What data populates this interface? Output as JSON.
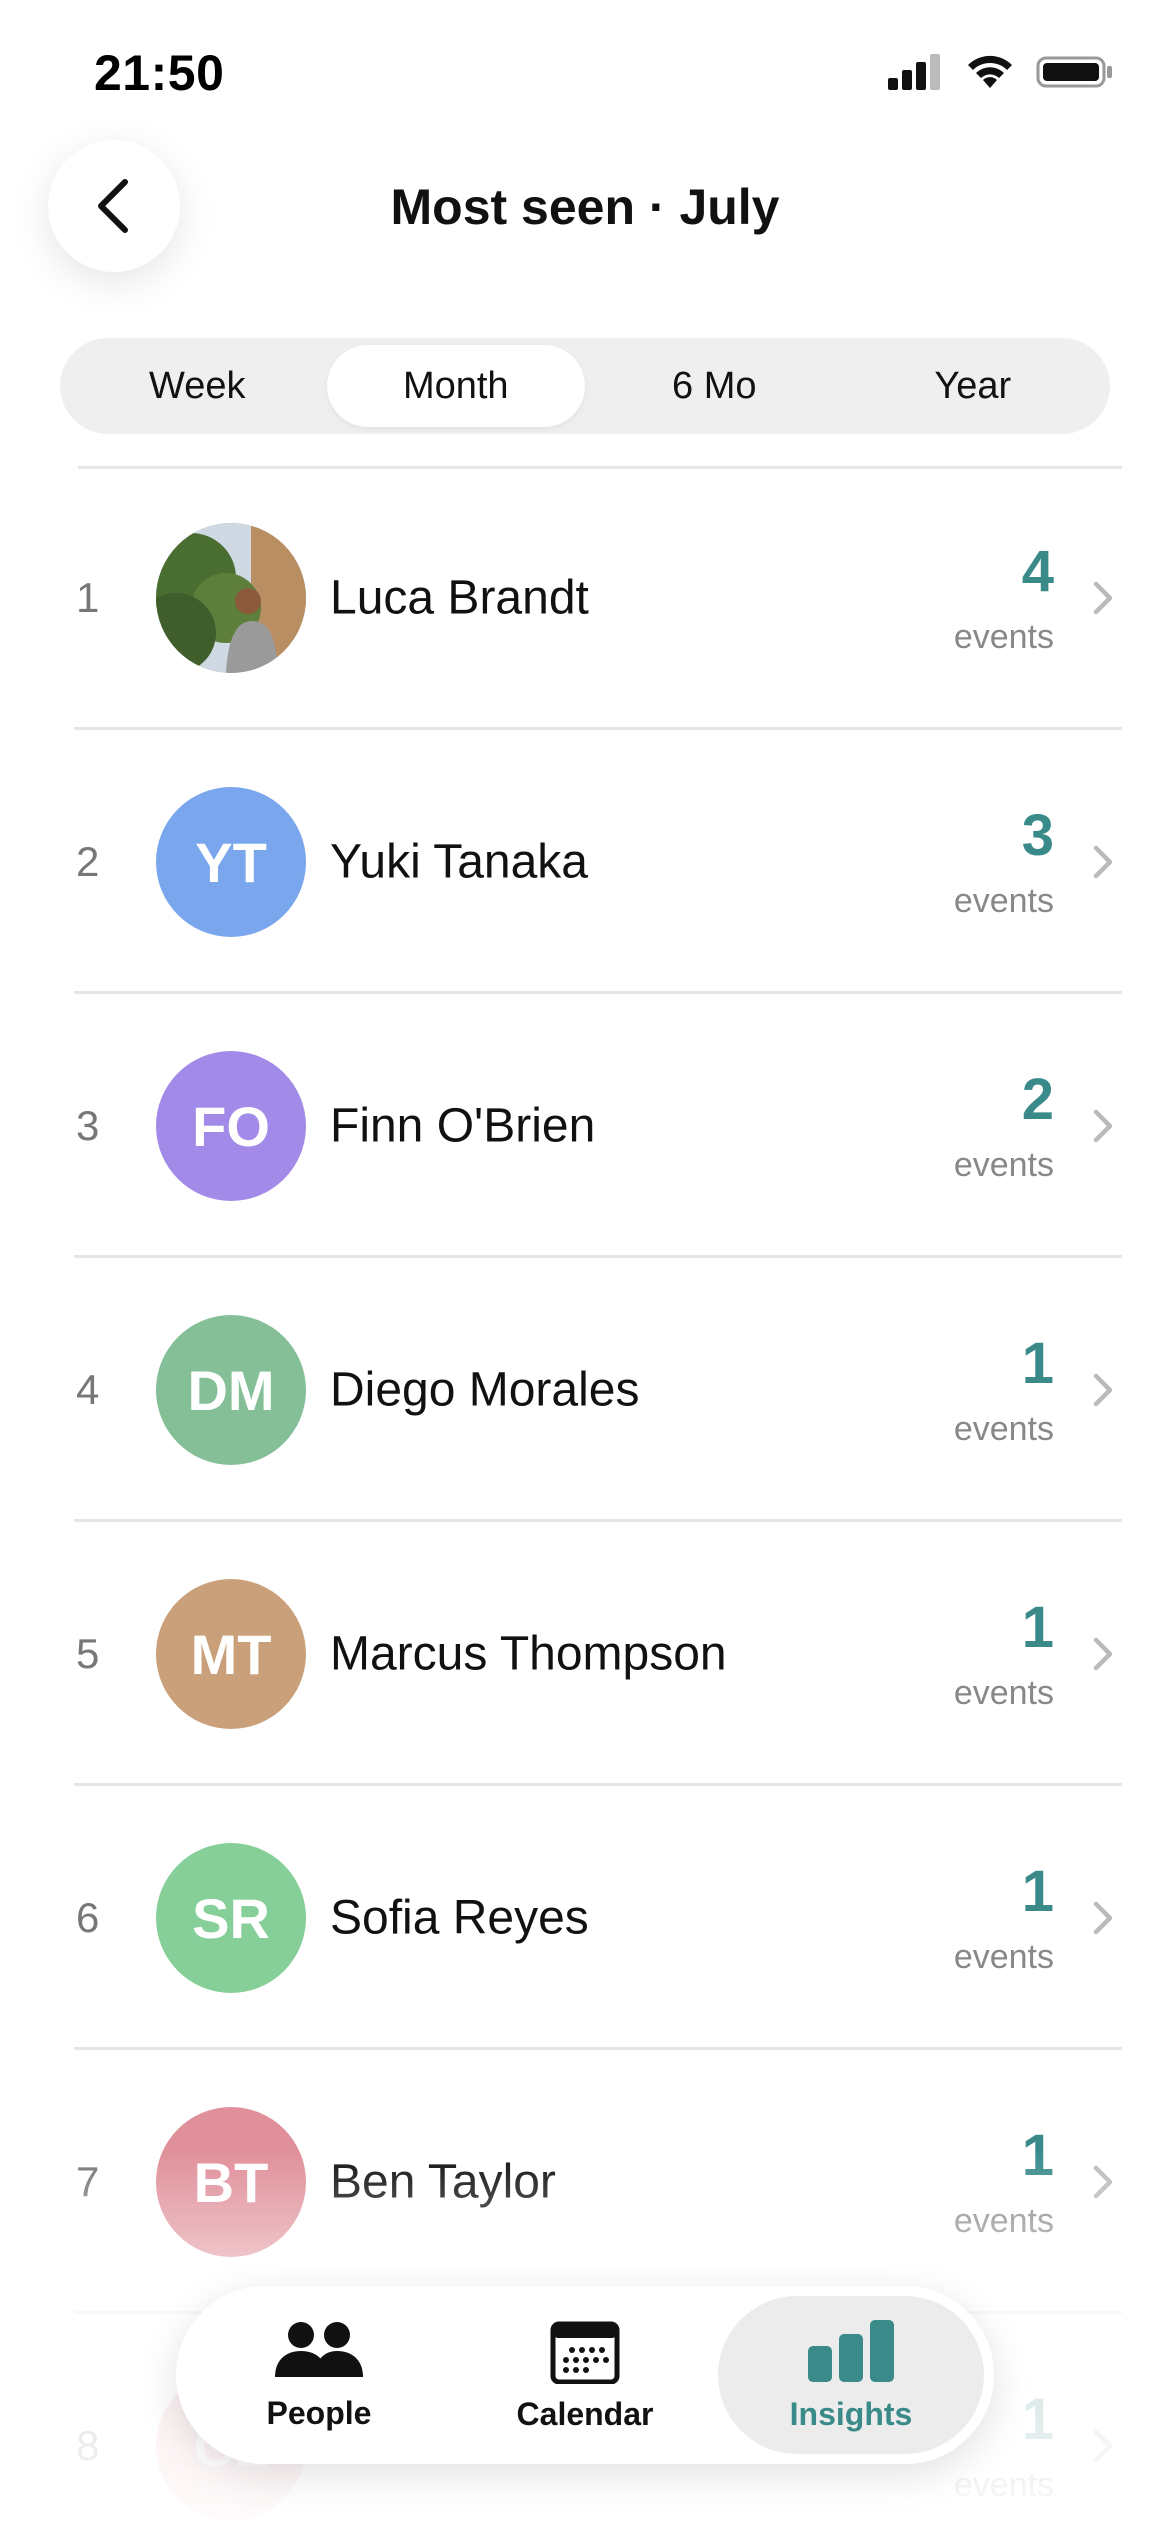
{
  "status_bar": {
    "time": "21:50"
  },
  "header": {
    "title": "Most seen · July"
  },
  "segments": [
    {
      "label": "Week",
      "active": false
    },
    {
      "label": "Month",
      "active": true
    },
    {
      "label": "6 Mo",
      "active": false
    },
    {
      "label": "Year",
      "active": false
    }
  ],
  "colors": {
    "accent": "#3a8a8a"
  },
  "people": [
    {
      "rank": "1",
      "name": "Luca Brandt",
      "initials": "",
      "photo": true,
      "count": "4",
      "unit": "events",
      "color": "#6b8f4e"
    },
    {
      "rank": "2",
      "name": "Yuki Tanaka",
      "initials": "YT",
      "photo": false,
      "count": "3",
      "unit": "events",
      "color": "#7aa6ee"
    },
    {
      "rank": "3",
      "name": "Finn O'Brien",
      "initials": "FO",
      "photo": false,
      "count": "2",
      "unit": "events",
      "color": "#a28ae8"
    },
    {
      "rank": "4",
      "name": "Diego Morales",
      "initials": "DM",
      "photo": false,
      "count": "1",
      "unit": "events",
      "color": "#84bf98"
    },
    {
      "rank": "5",
      "name": "Marcus Thompson",
      "initials": "MT",
      "photo": false,
      "count": "1",
      "unit": "events",
      "color": "#c9a07a"
    },
    {
      "rank": "6",
      "name": "Sofia Reyes",
      "initials": "SR",
      "photo": false,
      "count": "1",
      "unit": "events",
      "color": "#86cf98"
    },
    {
      "rank": "7",
      "name": "Ben Taylor",
      "initials": "BT",
      "photo": false,
      "count": "1",
      "unit": "events",
      "color": "#e0909a"
    },
    {
      "rank": "8",
      "name": "",
      "initials": "CL",
      "photo": false,
      "count": "1",
      "unit": "events",
      "color": "#f0b3b8"
    }
  ],
  "tabs": [
    {
      "label": "People",
      "icon": "people-icon",
      "active": false
    },
    {
      "label": "Calendar",
      "icon": "calendar-icon",
      "active": false
    },
    {
      "label": "Insights",
      "icon": "bar-chart-icon",
      "active": true
    }
  ]
}
